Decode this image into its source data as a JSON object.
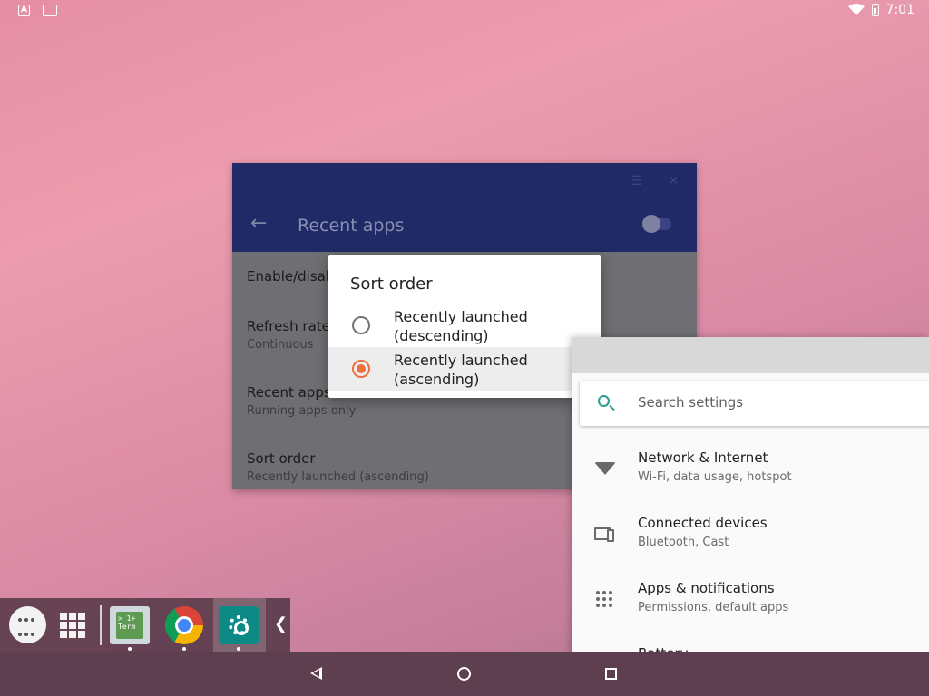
{
  "status_bar": {
    "time": "7:01",
    "notification_icons": [
      "a-icon",
      "screenshot-icon"
    ],
    "indicators": [
      "wifi-icon",
      "battery-icon"
    ]
  },
  "background_window": {
    "title": "Recent apps",
    "items": [
      {
        "title": "Enable/disab",
        "subtitle": ""
      },
      {
        "title": "Refresh rate",
        "subtitle": "Continuous"
      },
      {
        "title": "Recent apps",
        "subtitle": "Running apps only"
      },
      {
        "title": "Sort order",
        "subtitle": "Recently launched (ascending)"
      }
    ]
  },
  "dialog": {
    "title": "Sort order",
    "options": [
      {
        "label": "Recently launched (descending)",
        "selected": false
      },
      {
        "label": "Recently launched (ascending)",
        "selected": true
      }
    ],
    "accent_color": "#ee6f3e"
  },
  "settings_window": {
    "search_placeholder": "Search settings",
    "items": [
      {
        "title": "Network & Internet",
        "subtitle": "Wi-Fi, data usage, hotspot",
        "icon": "wifi-icon"
      },
      {
        "title": "Connected devices",
        "subtitle": "Bluetooth, Cast",
        "icon": "devices-icon"
      },
      {
        "title": "Apps & notifications",
        "subtitle": "Permissions, default apps",
        "icon": "apps-icon"
      },
      {
        "title": "Battery",
        "subtitle": "",
        "icon": "battery-icon"
      }
    ]
  },
  "taskbar": {
    "term_icon_text": "> 1+\nTerm",
    "apps": [
      "app-drawer-icon",
      "grid-icon",
      "terminal-app-icon",
      "chrome-app-icon",
      "settings-app-icon"
    ]
  },
  "colors": {
    "titlebar": "#1f2a66",
    "accent": "#ee6f3e",
    "search_icon": "#2a9d8f"
  }
}
